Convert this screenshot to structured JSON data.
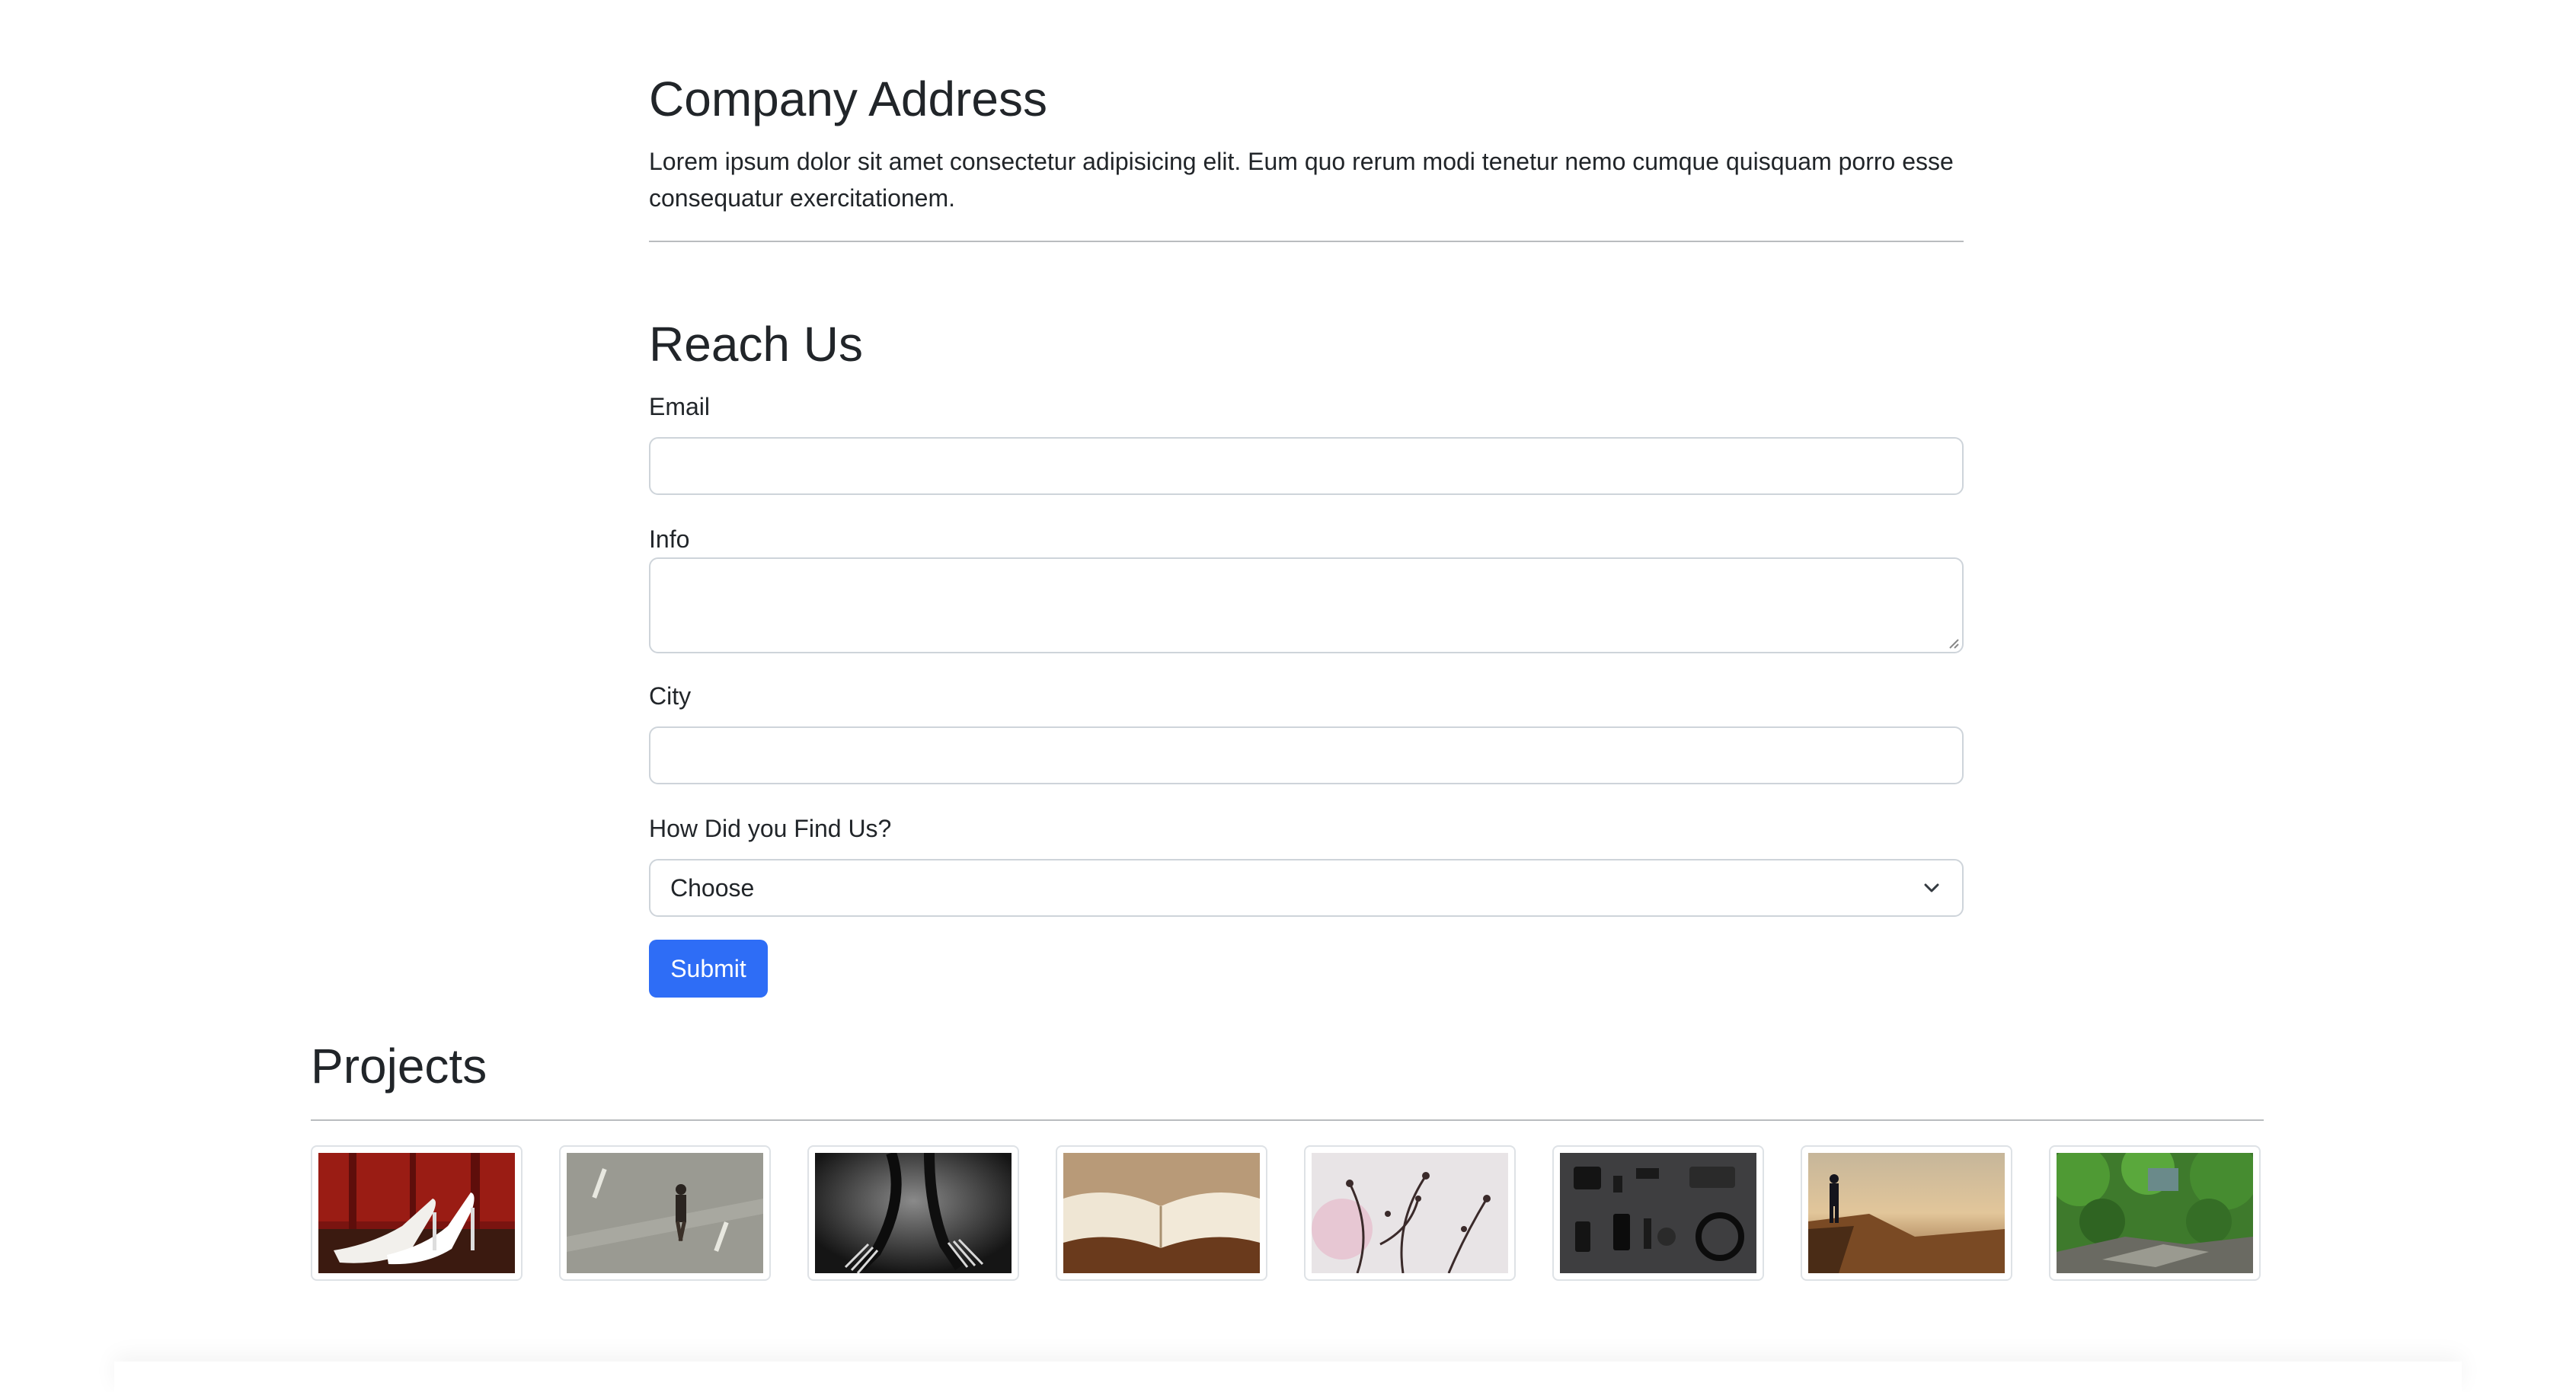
{
  "company_address": {
    "title": "Company Address",
    "text": "Lorem ipsum dolor sit amet consectetur adipisicing elit. Eum quo rerum modi tenetur nemo cumque quisquam porro esse consequatur exercitationem."
  },
  "reach_us": {
    "title": "Reach Us",
    "email_label": "Email",
    "email_value": "",
    "info_label": "Info",
    "info_value": "",
    "city_label": "City",
    "city_value": "",
    "find_label": "How Did you Find Us?",
    "find_selected": "Choose",
    "submit_label": "Submit"
  },
  "projects": {
    "title": "Projects",
    "thumbnails": [
      {
        "subject": "white high heels on red stage"
      },
      {
        "subject": "man walking on street"
      },
      {
        "subject": "forks dark closeup"
      },
      {
        "subject": "open book"
      },
      {
        "subject": "blossom branches"
      },
      {
        "subject": "flat lay accessories"
      },
      {
        "subject": "man on cliff at sunset"
      },
      {
        "subject": "green forest river"
      }
    ]
  },
  "colors": {
    "primary_button": "#2e6df6",
    "text": "#212529",
    "border": "#ced4da"
  }
}
